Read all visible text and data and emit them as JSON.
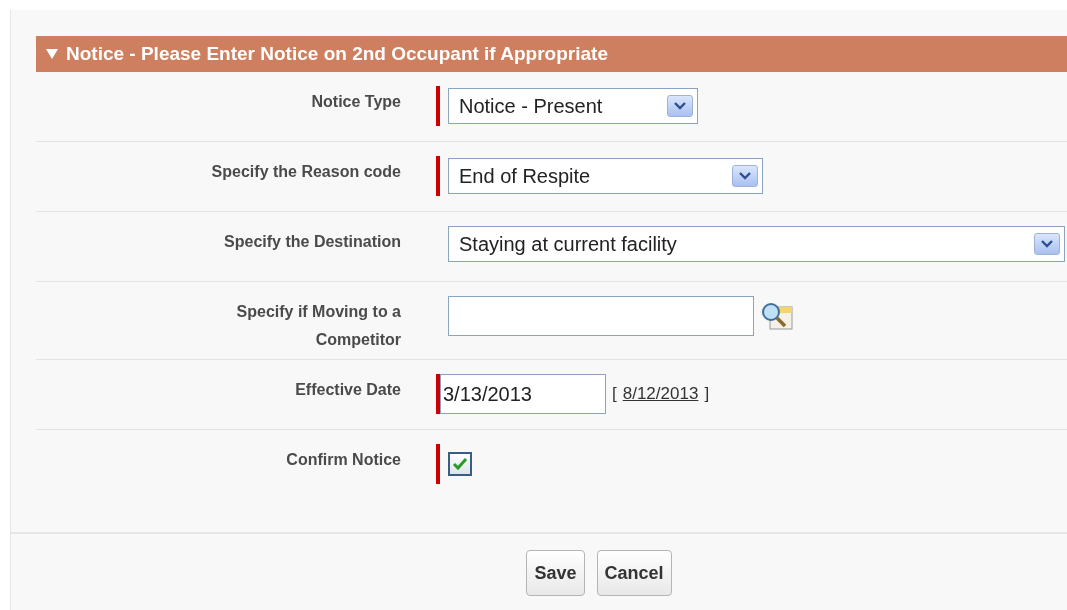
{
  "section": {
    "title": "Notice - Please Enter Notice on 2nd Occupant if Appropriate",
    "expanded": true
  },
  "fields": [
    {
      "kind": "select",
      "label": "Notice Type",
      "required": true,
      "value": "Notice - Present"
    },
    {
      "kind": "select",
      "label": "Specify the Reason code",
      "required": true,
      "value": "End of Respite"
    },
    {
      "kind": "select",
      "label": "Specify the Destination",
      "required": false,
      "value": "Staying at current facility"
    },
    {
      "kind": "lookup",
      "label": "Specify if Moving to a Competitor",
      "required": false
    },
    {
      "kind": "date",
      "label": "Effective Date",
      "required": true,
      "value": "3/13/2013",
      "open": "[",
      "link": "8/12/2013",
      "close": "]"
    },
    {
      "kind": "checkbox",
      "label": "Confirm Notice",
      "required": true,
      "checked": true
    }
  ],
  "buttons": [
    "Save",
    "Cancel"
  ]
}
